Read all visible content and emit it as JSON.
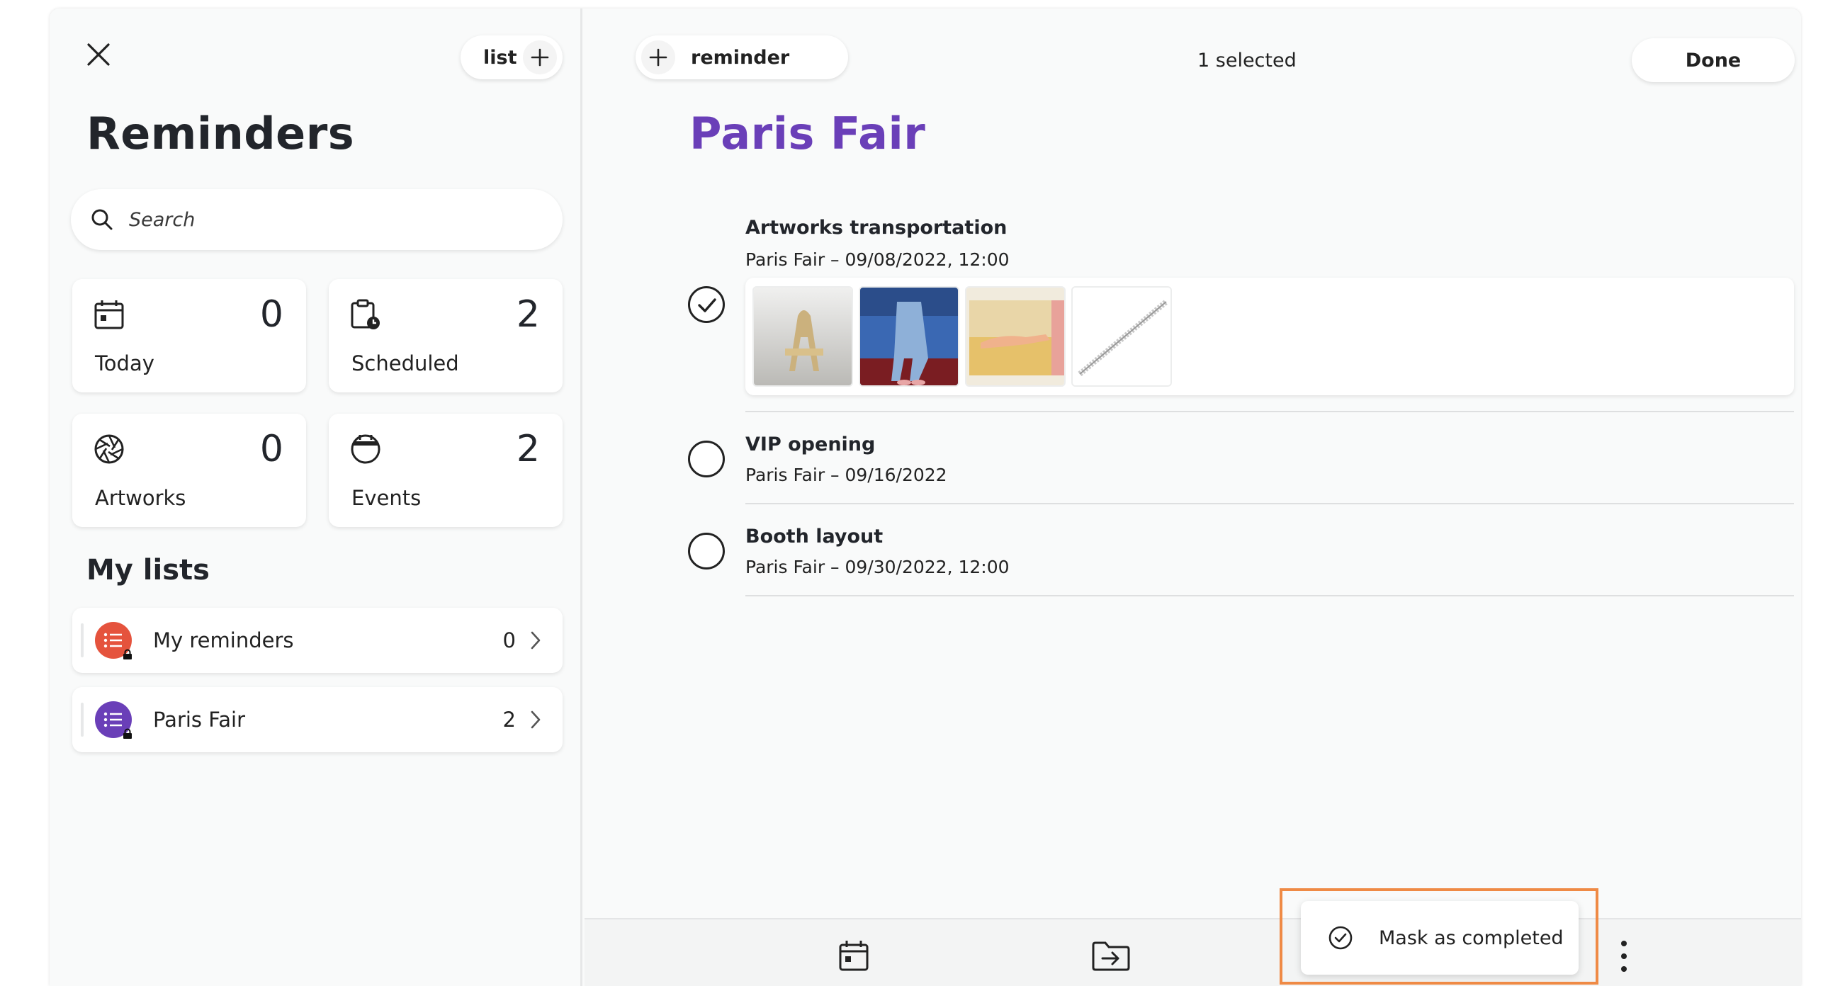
{
  "sidebar": {
    "close_icon": "close-icon",
    "add_list_label": "list",
    "title": "Reminders",
    "search": {
      "placeholder": "Search",
      "value": ""
    },
    "smart_lists": [
      {
        "label": "Today",
        "count": "0",
        "icon": "calendar-day-icon"
      },
      {
        "label": "Scheduled",
        "count": "2",
        "icon": "clipboard-clock-icon"
      },
      {
        "label": "Artworks",
        "count": "0",
        "icon": "aperture-icon"
      },
      {
        "label": "Events",
        "count": "2",
        "icon": "calendar-round-icon"
      }
    ],
    "my_lists_title": "My lists",
    "lists": [
      {
        "name": "My reminders",
        "count": "0",
        "color": "#e5533d"
      },
      {
        "name": "Paris Fair",
        "count": "2",
        "color": "#6a3fb8"
      }
    ]
  },
  "main": {
    "add_reminder_label": "reminder",
    "selected_text": "1 selected",
    "done_label": "Done",
    "list_title": "Paris Fair",
    "items": [
      {
        "title": "Artworks transportation",
        "subtitle": "Paris Fair – 09/08/2022, 12:00",
        "checked": true
      },
      {
        "title": "VIP opening",
        "subtitle": "Paris Fair – 09/16/2022",
        "checked": false
      },
      {
        "title": "Booth layout",
        "subtitle": "Paris Fair – 09/30/2022, 12:00",
        "checked": false
      }
    ],
    "thumbnails": [
      "artwork-chair",
      "artwork-seated-figure",
      "artwork-reclining-figure",
      "artwork-bracelet"
    ]
  },
  "bottom_bar": {
    "icons": [
      "calendar-day-icon",
      "move-to-folder-icon",
      "more-vertical-icon"
    ]
  },
  "popup": {
    "label": "Mask as completed",
    "icon": "check-circle-icon"
  },
  "colors": {
    "accent_purple": "#6a3fb8",
    "accent_red": "#e5533d",
    "highlight_orange": "#ef8a45"
  }
}
